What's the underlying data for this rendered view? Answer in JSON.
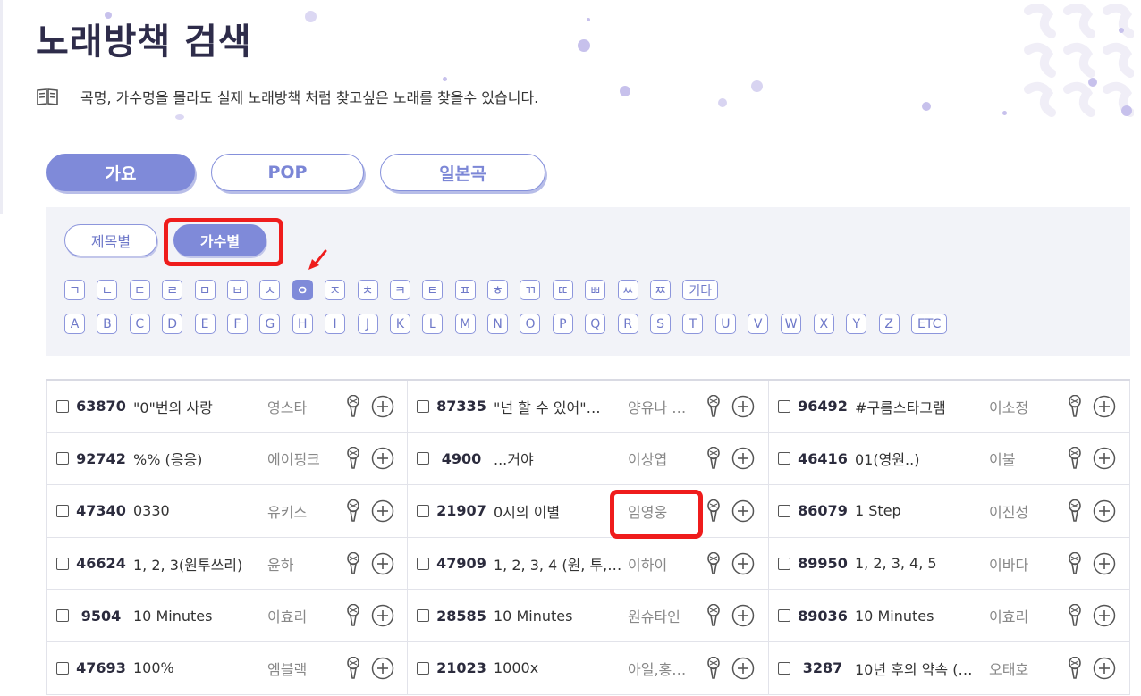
{
  "page": {
    "title": "노래방책 검색",
    "description": "곡명, 가수명을 몰라도 실제 노래방책 처럼 찾고싶은 노래를 찾을수 있습니다."
  },
  "tabs": [
    {
      "label": "가요",
      "active": true
    },
    {
      "label": "POP",
      "active": false
    },
    {
      "label": "일본곡",
      "active": false
    }
  ],
  "subtabs": [
    {
      "label": "제목별",
      "active": false
    },
    {
      "label": "가수별",
      "active": true
    }
  ],
  "korean_letters": [
    "ㄱ",
    "ㄴ",
    "ㄷ",
    "ㄹ",
    "ㅁ",
    "ㅂ",
    "ㅅ",
    "ㅇ",
    "ㅈ",
    "ㅊ",
    "ㅋ",
    "ㅌ",
    "ㅍ",
    "ㅎ",
    "ㄲ",
    "ㄸ",
    "ㅃ",
    "ㅆ",
    "ㅉ",
    "기타"
  ],
  "english_letters": [
    "A",
    "B",
    "C",
    "D",
    "E",
    "F",
    "G",
    "H",
    "I",
    "J",
    "K",
    "L",
    "M",
    "N",
    "O",
    "P",
    "Q",
    "R",
    "S",
    "T",
    "U",
    "V",
    "W",
    "X",
    "Y",
    "Z",
    "ETC"
  ],
  "active_letter": "ㅇ",
  "songs": [
    [
      {
        "num": "63870",
        "title": "\"0\"번의 사랑",
        "singer": "영스타"
      },
      {
        "num": "87335",
        "title": "\"넌 할 수 있어\"…",
        "singer": "양유나 …"
      },
      {
        "num": "96492",
        "title": "#구름스타그램",
        "singer": "이소정"
      }
    ],
    [
      {
        "num": "92742",
        "title": "%% (응응)",
        "singer": "에이핑크"
      },
      {
        "num": "4900",
        "title": "...거야",
        "singer": "이상엽"
      },
      {
        "num": "46416",
        "title": "01(영원..)",
        "singer": "이불"
      }
    ],
    [
      {
        "num": "47340",
        "title": "0330",
        "singer": "유키스"
      },
      {
        "num": "21907",
        "title": "0시의 이별",
        "singer": "임영웅"
      },
      {
        "num": "86079",
        "title": "1 Step",
        "singer": "이진성"
      }
    ],
    [
      {
        "num": "46624",
        "title": "1, 2, 3(원투쓰리)",
        "singer": "윤하"
      },
      {
        "num": "47909",
        "title": "1, 2, 3, 4 (원, 투,…",
        "singer": "이하이"
      },
      {
        "num": "89950",
        "title": "1, 2, 3, 4, 5",
        "singer": "이바다"
      }
    ],
    [
      {
        "num": "9504",
        "title": "10 Minutes",
        "singer": "이효리"
      },
      {
        "num": "28585",
        "title": "10 Minutes",
        "singer": "원슈타인"
      },
      {
        "num": "89036",
        "title": "10 Minutes",
        "singer": "이효리"
      }
    ],
    [
      {
        "num": "47693",
        "title": "100%",
        "singer": "엠블랙"
      },
      {
        "num": "21023",
        "title": "1000x",
        "singer": "아일,홍…"
      },
      {
        "num": "3287",
        "title": "10년 후의 약속 (…",
        "singer": "오태호"
      }
    ]
  ],
  "colors": {
    "accent": "#7f8ad9",
    "highlight": "#ef1c1c",
    "panel": "#f2f3f8",
    "title": "#2e2c4a"
  },
  "icons": {
    "description": "book-icon",
    "row_mic": "microphone-icon",
    "row_add": "plus-circle-icon",
    "pointer": "red-arrow-icon"
  }
}
